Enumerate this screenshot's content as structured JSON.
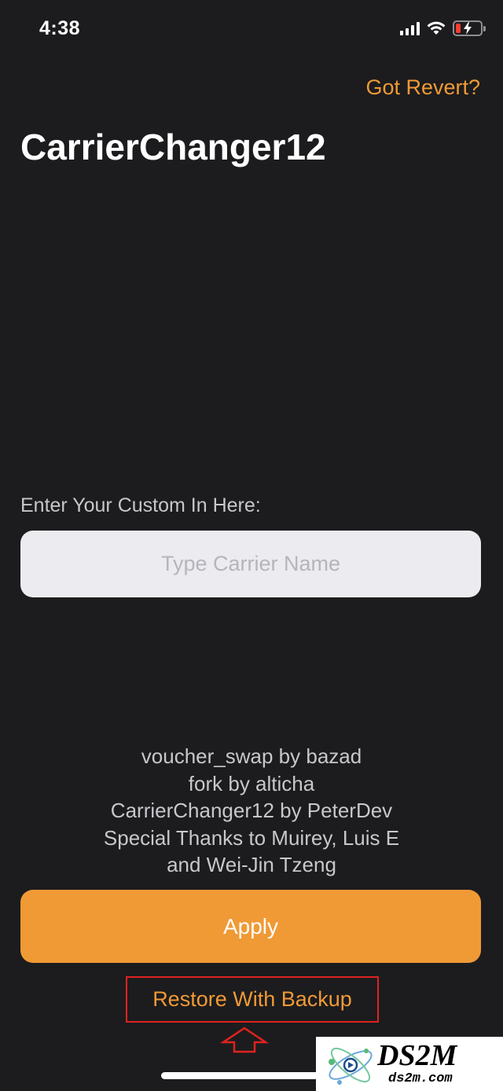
{
  "status_bar": {
    "time": "4:38",
    "battery_level": 0.2,
    "battery_color": "#ff3b30"
  },
  "header": {
    "revert_link": "Got Revert?",
    "title": "CarrierChanger12"
  },
  "custom_input": {
    "label": "Enter Your Custom In Here:",
    "placeholder": "Type Carrier Name",
    "value": ""
  },
  "credits": [
    "voucher_swap by bazad",
    "fork by alticha",
    "CarrierChanger12 by PeterDev",
    "Special Thanks to Muirey, Luis E",
    "and Wei-Jin Tzeng"
  ],
  "actions": {
    "apply_label": "Apply",
    "restore_label": "Restore With Backup"
  },
  "watermark": {
    "brand": "DS2M",
    "site": "ds2m.com"
  },
  "colors": {
    "background": "#1c1c1e",
    "accent": "#f09a36",
    "highlight_box": "#e0221f"
  }
}
